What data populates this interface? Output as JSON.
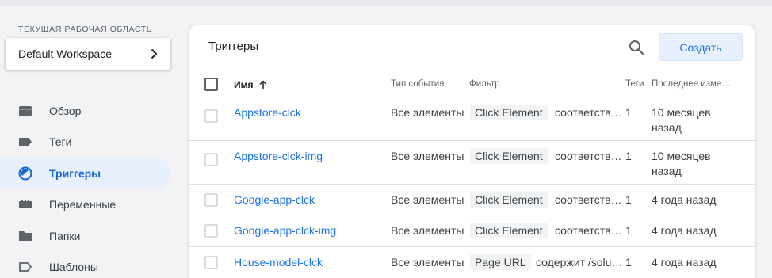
{
  "sidebar": {
    "workspace_label": "ТЕКУЩАЯ РАБОЧАЯ ОБЛАСТЬ",
    "workspace_name": "Default Workspace",
    "items": [
      {
        "label": "Обзор",
        "icon": "folder-tab-icon"
      },
      {
        "label": "Теги",
        "icon": "tag-icon"
      },
      {
        "label": "Триггеры",
        "icon": "trigger-icon",
        "active": true
      },
      {
        "label": "Переменные",
        "icon": "variables-icon"
      },
      {
        "label": "Папки",
        "icon": "folder-icon"
      },
      {
        "label": "Шаблоны",
        "icon": "template-label-icon"
      }
    ]
  },
  "panel": {
    "title": "Триггеры",
    "create_label": "Создать"
  },
  "table": {
    "headers": {
      "name": "Имя",
      "event_type": "Тип события",
      "filter": "Фильтр",
      "tags": "Теги",
      "modified": "Последнее изме…"
    },
    "rows": [
      {
        "name": "Appstore-clck",
        "event_type": "Все элементы",
        "filter_var": "Click Element",
        "filter_cond": "соответств…",
        "tags": "1",
        "modified": "10 месяцев назад"
      },
      {
        "name": "Appstore-clck-img",
        "event_type": "Все элементы",
        "filter_var": "Click Element",
        "filter_cond": "соответств…",
        "tags": "1",
        "modified": "10 месяцев назад"
      },
      {
        "name": "Google-app-clck",
        "event_type": "Все элементы",
        "filter_var": "Click Element",
        "filter_cond": "соответств…",
        "tags": "1",
        "modified": "4 года назад"
      },
      {
        "name": "Google-app-clck-img",
        "event_type": "Все элементы",
        "filter_var": "Click Element",
        "filter_cond": "соответств…",
        "tags": "1",
        "modified": "4 года назад"
      },
      {
        "name": "House-model-clck",
        "event_type": "Все элементы",
        "filter_var": "Page URL",
        "filter_cond": "содержит /solu…",
        "tags": "1",
        "modified": "4 года назад"
      }
    ]
  },
  "colors": {
    "accent": "#1a73e8",
    "active_bg": "#e8f0fe",
    "page_bg": "#f1f3f4"
  }
}
